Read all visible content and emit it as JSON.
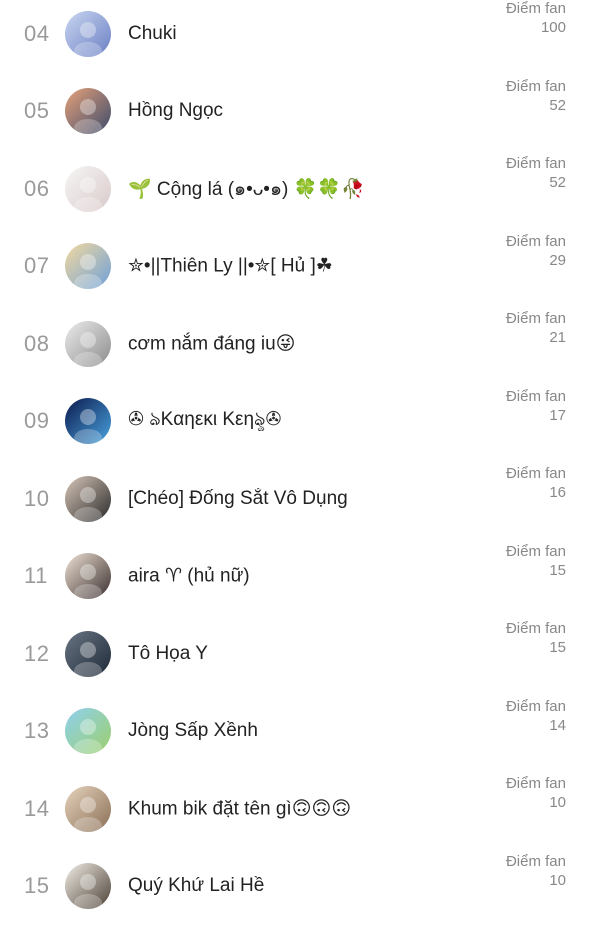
{
  "fan_list": {
    "entries": [
      {
        "rank": "04",
        "name": "Chuki",
        "score_label": "Điểm fan",
        "score": "100"
      },
      {
        "rank": "05",
        "name": "Hồng Ngọc",
        "score_label": "Điểm fan",
        "score": "52"
      },
      {
        "rank": "06",
        "name": "🌱 Cộng lá (๑•ᴗ•๑) 🍀🍀🥀",
        "score_label": "Điểm fan",
        "score": "52"
      },
      {
        "rank": "07",
        "name": "✮•||Thiên Ly ||•✮[ Hủ ]☘",
        "score_label": "Điểm fan",
        "score": "29"
      },
      {
        "rank": "08",
        "name": "cơm nắm đáng iu😜",
        "score_label": "Điểm fan",
        "score": "21"
      },
      {
        "rank": "09",
        "name": "✇ ঌKαηεκι Kεηৡ✇",
        "score_label": "Điểm fan",
        "score": "17"
      },
      {
        "rank": "10",
        "name": "[Chéo] Đống Sắt Vô Dụng",
        "score_label": "Điểm fan",
        "score": "16"
      },
      {
        "rank": "11",
        "name": "aira ♈ (hủ nữ)",
        "score_label": "Điểm fan",
        "score": "15"
      },
      {
        "rank": "12",
        "name": "Tô Họa Y",
        "score_label": "Điểm fan",
        "score": "15"
      },
      {
        "rank": "13",
        "name": "Jòng Sấp Xềnh",
        "score_label": "Điểm fan",
        "score": "14"
      },
      {
        "rank": "14",
        "name": "Khum bik đặt tên gì🙃🙃🙃",
        "score_label": "Điểm fan",
        "score": "10"
      },
      {
        "rank": "15",
        "name": "Quý Khứ Lai Hề",
        "score_label": "Điểm fan",
        "score": "10"
      }
    ],
    "avatar_colors": [
      [
        "#c9d6f0",
        "#6a7fc4"
      ],
      [
        "#e8a27a",
        "#3b4a6b"
      ],
      [
        "#f6f6f6",
        "#d9c9c9"
      ],
      [
        "#f3d9a0",
        "#6fa0d8"
      ],
      [
        "#ececec",
        "#8b8b8b"
      ],
      [
        "#0b1a4d",
        "#4aa3e0"
      ],
      [
        "#d8c6b8",
        "#2a2a2a"
      ],
      [
        "#efe2d4",
        "#3a2f2f"
      ],
      [
        "#6a7584",
        "#1f2a38"
      ],
      [
        "#8fd0f0",
        "#9ccf6a"
      ],
      [
        "#e6d3bd",
        "#8a6e55"
      ],
      [
        "#f2eee6",
        "#4b4036"
      ]
    ]
  }
}
